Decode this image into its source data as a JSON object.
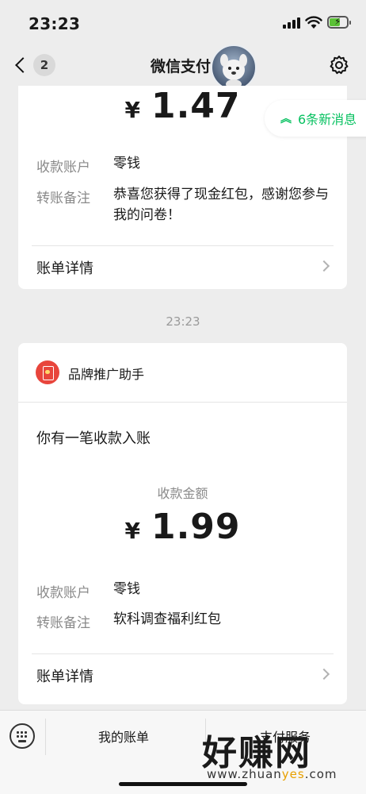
{
  "status_bar": {
    "time": "23:23",
    "battery_charging": true
  },
  "nav": {
    "unread_count": "2",
    "title": "微信支付"
  },
  "new_messages": {
    "label": "6条新消息"
  },
  "card_top": {
    "amount_currency": "¥",
    "amount": "1.47",
    "account_label": "收款账户",
    "account_value": "零钱",
    "remark_label": "转账备注",
    "remark_value": "恭喜您获得了现金红包，感谢您参与我的问卷！",
    "detail_label": "账单详情"
  },
  "time_separator": "23:23",
  "card_bottom": {
    "brand_name": "品牌推广助手",
    "notice_title": "你有一笔收款入账",
    "amount_caption": "收款金额",
    "amount_currency": "¥",
    "amount": "1.99",
    "account_label": "收款账户",
    "account_value": "零钱",
    "remark_label": "转账备注",
    "remark_value": "软科调查福利红包",
    "detail_label": "账单详情"
  },
  "bottom_menu": {
    "my_bill": "我的账单",
    "pay_service": "支付服务"
  },
  "watermark": {
    "big": "好赚网",
    "small_prefix": "www.zhuan",
    "small_highlight": "yes",
    "small_suffix": ".com"
  },
  "colors": {
    "accent_green": "#07c160",
    "brand_red": "#e8453c",
    "background": "#ededed"
  },
  "icons": [
    "back-chevron-icon",
    "settings-gear-icon",
    "double-chevron-up-icon",
    "chevron-right-icon",
    "red-packet-icon",
    "keyboard-icon"
  ]
}
